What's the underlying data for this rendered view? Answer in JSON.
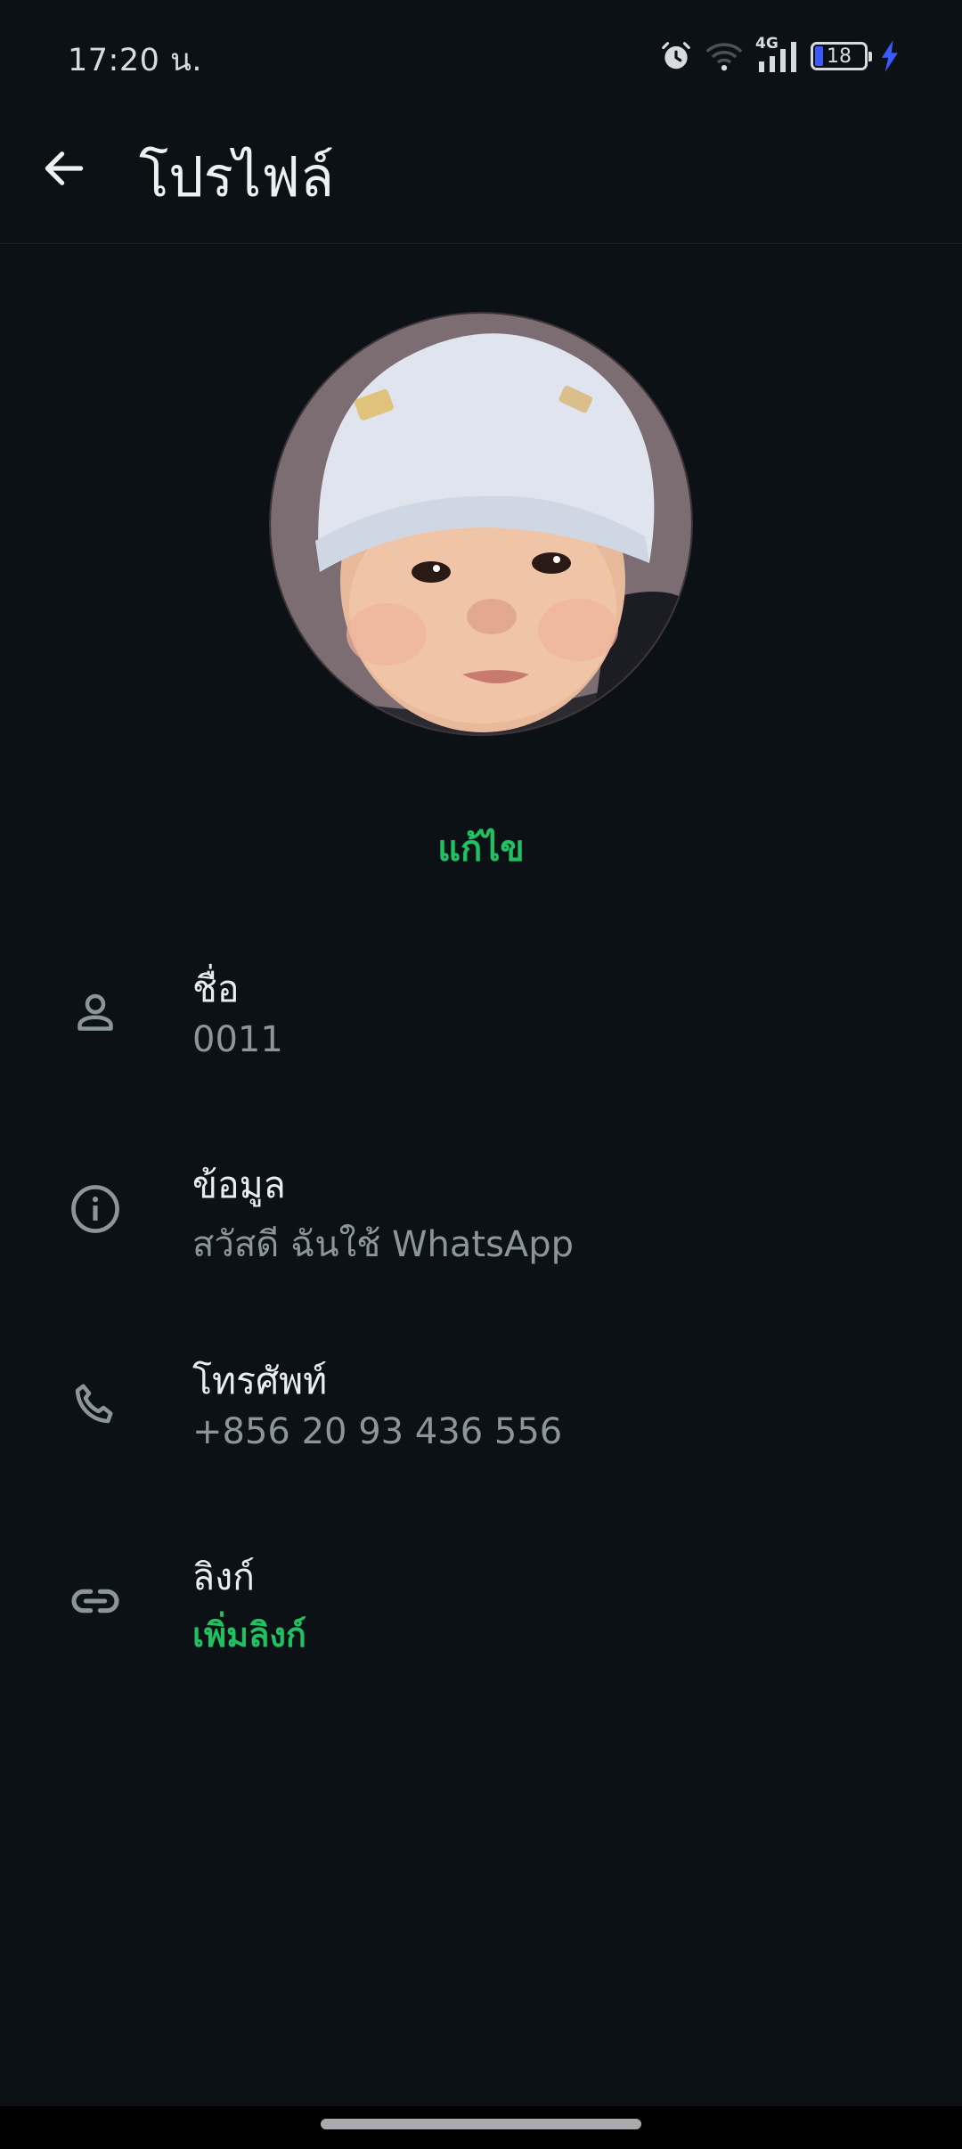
{
  "status_bar": {
    "time": "17:20 น.",
    "network": "4G",
    "battery_level": "18",
    "icons": [
      "alarm-icon",
      "wifi-icon",
      "signal-icon",
      "battery-icon",
      "charging-icon"
    ]
  },
  "header": {
    "title": "โปรไฟล์",
    "back_icon": "arrow-left-icon"
  },
  "profile": {
    "edit_label": "แก้ไข"
  },
  "rows": [
    {
      "icon": "person-icon",
      "label": "ชื่อ",
      "value": "0011"
    },
    {
      "icon": "info-icon",
      "label": "ข้อมูล",
      "value": "สวัสดี ฉันใช้ WhatsApp"
    },
    {
      "icon": "phone-icon",
      "label": "โทรศัพท์",
      "value": "+856 20 93 436 556"
    },
    {
      "icon": "link-icon",
      "label": "ลิงก์",
      "value": "เพิ่มลิงก์"
    }
  ],
  "colors": {
    "background": "#0b1114",
    "accent": "#21c063",
    "secondary_text": "#8b969c",
    "icon": "#8b969c",
    "charging": "#3b5bff"
  }
}
